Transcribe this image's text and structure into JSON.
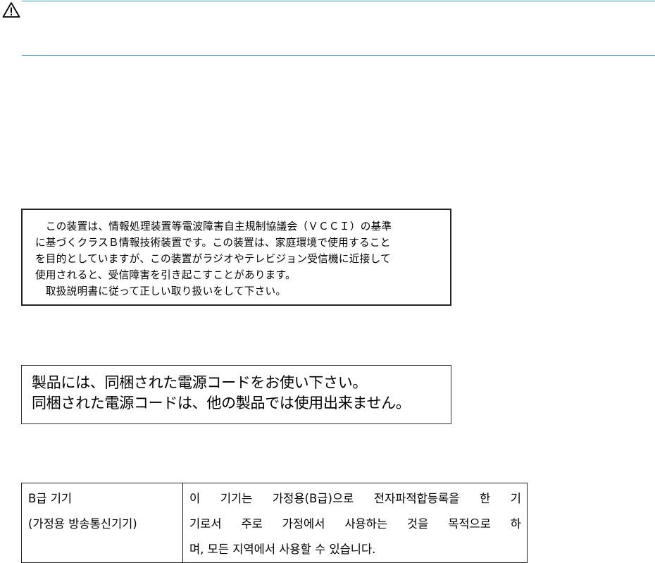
{
  "header": {
    "icon": "warning-icon"
  },
  "vcci_notice": {
    "lines": [
      "　この装置は、情報処理装置等電波障害自主規制協議会（ＶＣＣＩ）の基準",
      "に基づくクラスＢ情報技術装置です。この装置は、家庭環境で使用すること",
      "を目的としていますが、この装置がラジオやテレビジョン受信機に近接して",
      "使用されると、受信障害を引き起こすことがあります。",
      "　取扱説明書に従って正しい取り扱いをして下さい。"
    ]
  },
  "power_cord_notice": {
    "lines": [
      "製品には、同梱された電源コードをお使い下さい。",
      "同梱された電源コードは、他の製品では使用出来ません。"
    ]
  },
  "korean_notice": {
    "left_lines": [
      "B급 기기",
      "(가정용 방송통신기기)"
    ],
    "right_lines": [
      "이 기기는 가정용(B급)으로 전자파적합등록을 한 기",
      "기로서 주로 가정에서 사용하는 것을 목적으로 하",
      "며, 모든 지역에서 사용할 수 있습니다."
    ]
  }
}
